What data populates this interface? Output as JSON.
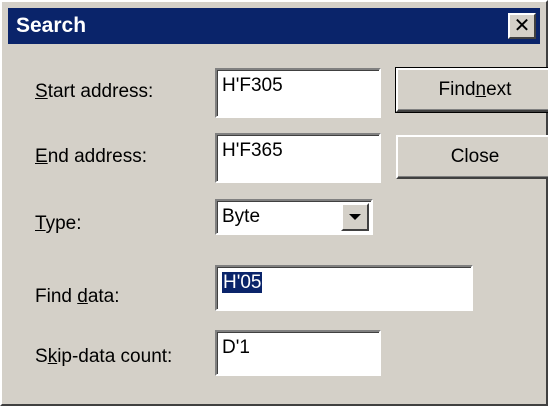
{
  "window": {
    "title": "Search",
    "close_glyph": "✕"
  },
  "fields": {
    "start_address": {
      "label_pre": "",
      "label_ul": "S",
      "label_post": "tart address:",
      "value": "H'F305"
    },
    "end_address": {
      "label_pre": "",
      "label_ul": "E",
      "label_post": "nd address:",
      "value": "H'F365"
    },
    "type": {
      "label_pre": "",
      "label_ul": "T",
      "label_post": "ype:",
      "value": "Byte"
    },
    "find_data": {
      "label_pre": "Find ",
      "label_ul": "d",
      "label_post": "ata:",
      "value": "H'05"
    },
    "skip_count": {
      "label_pre": "S",
      "label_ul": "k",
      "label_post": "ip-data count:",
      "value": "D'1"
    }
  },
  "buttons": {
    "find_next": {
      "pre": "Find ",
      "ul": "n",
      "post": "ext"
    },
    "close": {
      "label": "Close"
    }
  },
  "icons": {
    "close": "close-icon",
    "dropdown": "chevron-down-icon"
  }
}
